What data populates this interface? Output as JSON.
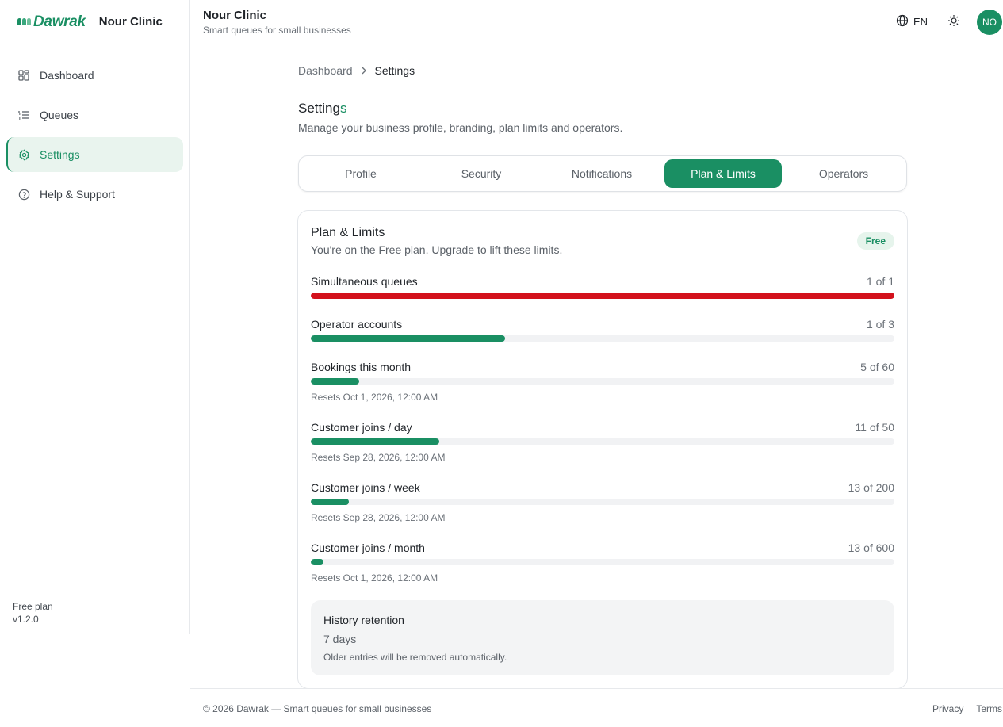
{
  "brand": {
    "logo_text": "Dawrak",
    "business_name": "Nour Clinic"
  },
  "sidebar": {
    "items": [
      {
        "label": "Dashboard",
        "icon": "grid-icon",
        "active": false
      },
      {
        "label": "Queues",
        "icon": "list-icon",
        "active": false
      },
      {
        "label": "Settings",
        "icon": "gear-icon",
        "active": true
      },
      {
        "label": "Help & Support",
        "icon": "help-circle-icon",
        "active": false
      }
    ],
    "plan_label": "Free plan",
    "version": "v1.2.0"
  },
  "header": {
    "title": "Nour Clinic",
    "subtitle": "Smart queues for small businesses",
    "language": "EN",
    "avatar_initials": "NO"
  },
  "breadcrumb": {
    "parent": "Dashboard",
    "current": "Settings"
  },
  "page": {
    "title_main": "Setting",
    "title_accent": "s",
    "description": "Manage your business profile, branding, plan limits and operators."
  },
  "tabs": [
    {
      "label": "Profile",
      "active": false
    },
    {
      "label": "Security",
      "active": false
    },
    {
      "label": "Notifications",
      "active": false
    },
    {
      "label": "Plan & Limits",
      "active": true
    },
    {
      "label": "Operators",
      "active": false
    }
  ],
  "plan_card": {
    "title": "Plan & Limits",
    "subtitle": "You're on the Free plan. Upgrade to lift these limits.",
    "badge": "Free",
    "limits": [
      {
        "name": "Simultaneous queues",
        "count": "1 of 1",
        "used": 1,
        "max": 1,
        "reset": ""
      },
      {
        "name": "Operator accounts",
        "count": "1 of 3",
        "used": 1,
        "max": 3,
        "reset": ""
      },
      {
        "name": "Bookings this month",
        "count": "5 of 60",
        "used": 5,
        "max": 60,
        "reset": "Resets Oct 1, 2026, 12:00 AM"
      },
      {
        "name": "Customer joins / day",
        "count": "11 of 50",
        "used": 11,
        "max": 50,
        "reset": "Resets Sep 28, 2026, 12:00 AM"
      },
      {
        "name": "Customer joins / week",
        "count": "13 of 200",
        "used": 13,
        "max": 200,
        "reset": "Resets Sep 28, 2026, 12:00 AM"
      },
      {
        "name": "Customer joins / month",
        "count": "13 of 600",
        "used": 13,
        "max": 600,
        "reset": "Resets Oct 1, 2026, 12:00 AM"
      }
    ],
    "history": {
      "title": "History retention",
      "value": "7 days",
      "note": "Older entries will be removed automatically."
    }
  },
  "footer": {
    "copyright": "© 2026 Dawrak — Smart queues for small businesses",
    "links": [
      "Privacy",
      "Terms"
    ]
  },
  "colors": {
    "accent": "#1a8f63",
    "limit_reached": "#d3111c",
    "active_nav_bg": "#e9f4ee"
  }
}
